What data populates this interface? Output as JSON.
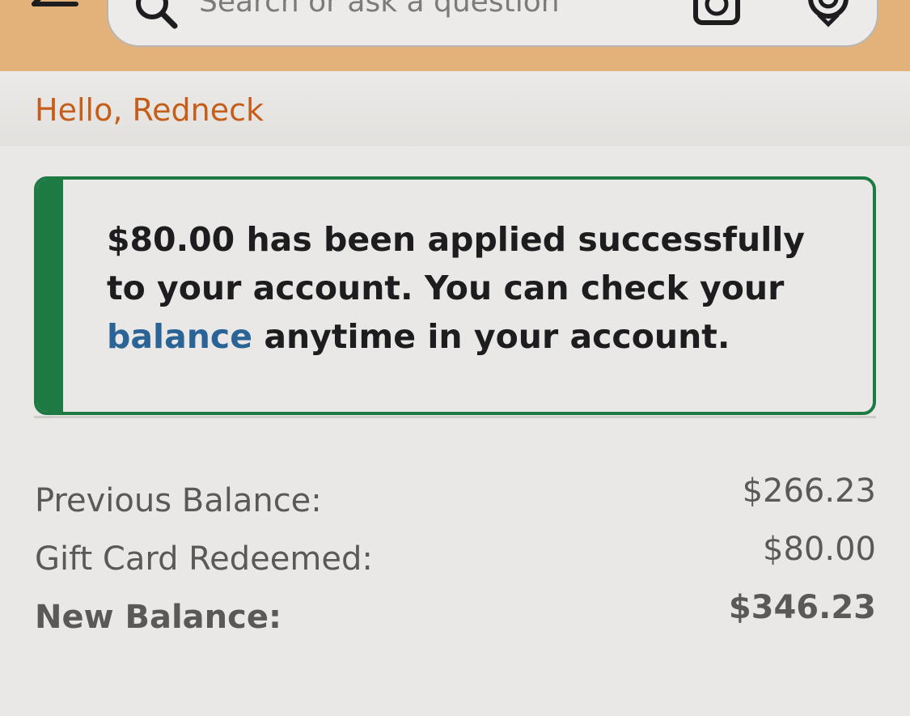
{
  "header": {
    "search_placeholder": "Search or ask a question",
    "back_icon": "back-arrow-icon",
    "search_icon": "search-icon",
    "camera_icon": "camera-icon",
    "mic_icon": "microphone-icon",
    "background_color": "#e2b27a"
  },
  "greeting": {
    "text": "Hello, Redneck",
    "color": "#c45e1a"
  },
  "alert": {
    "line_part1": "$80.00 has been applied successfully to your account. You can check your ",
    "link_text": "balance",
    "line_part2": " anytime in your account.",
    "accent_color": "#1e7a43",
    "link_color": "#2a6496"
  },
  "balances": [
    {
      "label": "Previous Balance:",
      "value": "$266.23"
    },
    {
      "label": "Gift Card Redeemed:",
      "value": "$80.00"
    },
    {
      "label": "New Balance:",
      "value": "$346.23"
    }
  ]
}
